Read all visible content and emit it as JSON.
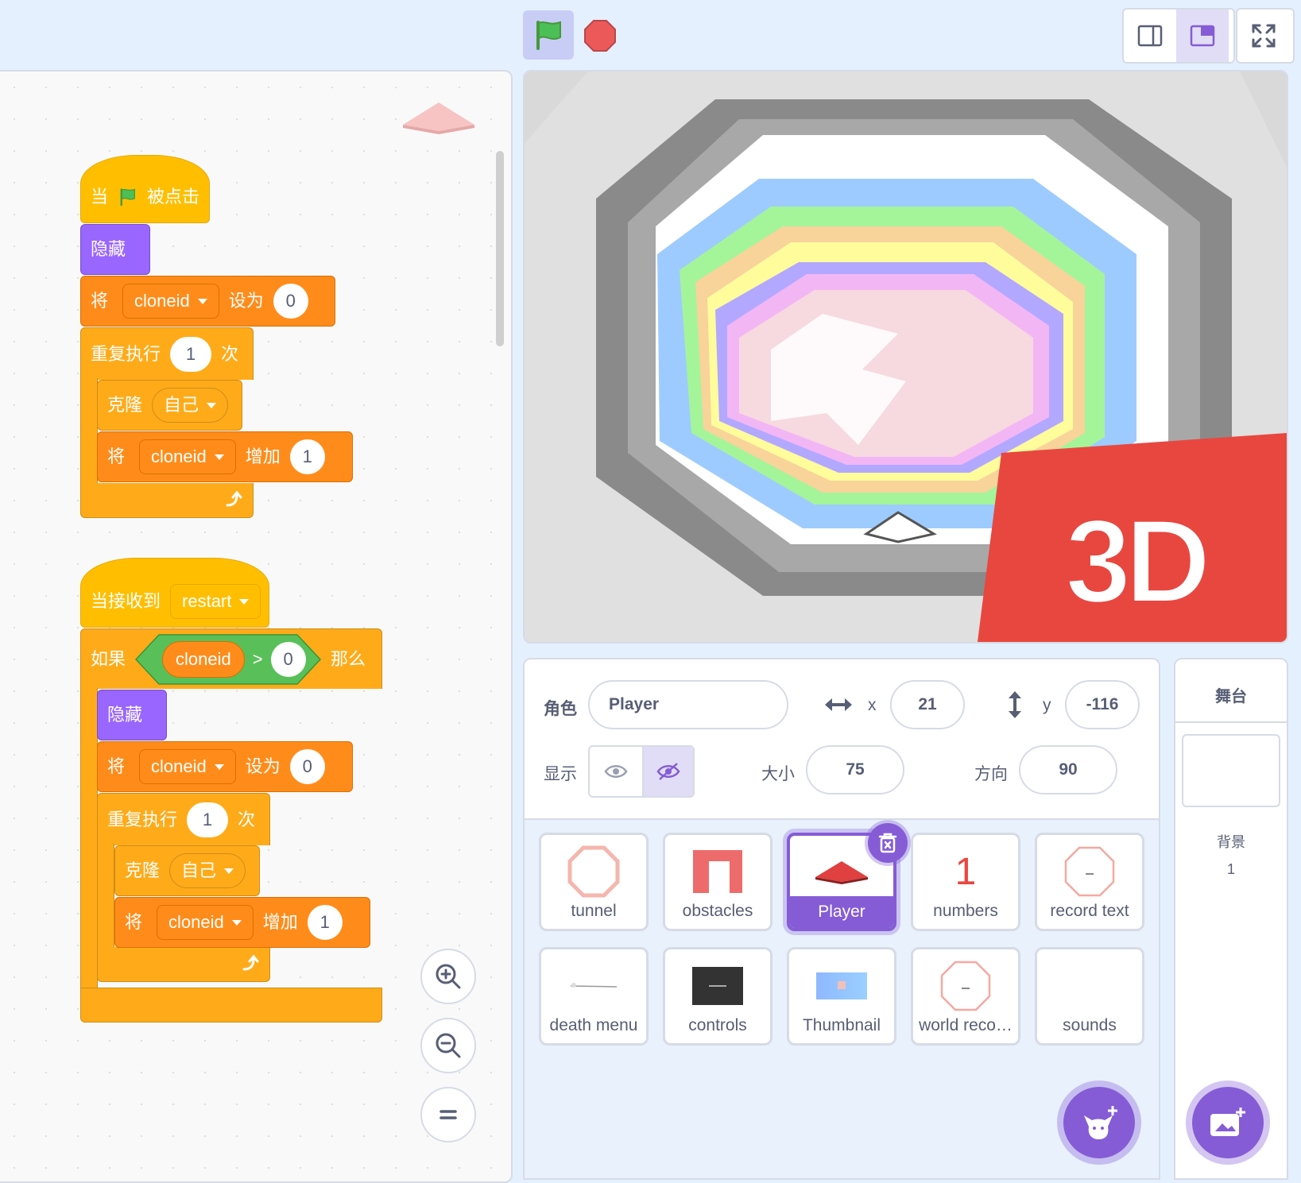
{
  "toolbar": {
    "green_flag_icon": "green-flag-icon",
    "stop_icon": "stop-icon",
    "modes": [
      "small-stage-icon",
      "normal-stage-icon",
      "fullscreen-icon"
    ]
  },
  "scripts": {
    "script1": {
      "hat_when": "当",
      "hat_clicked": "被点击",
      "hide": "隐藏",
      "set_label": "将",
      "set_var": "cloneid",
      "set_to": "设为",
      "set_value": "0",
      "repeat_label": "重复执行",
      "repeat_count": "1",
      "repeat_times": "次",
      "clone_label": "克隆",
      "clone_target": "自己",
      "change_label": "将",
      "change_var": "cloneid",
      "change_by": "增加",
      "change_value": "1"
    },
    "script2": {
      "hat_receive": "当接收到",
      "message": "restart",
      "if_label": "如果",
      "cond_var": "cloneid",
      "cond_op": ">",
      "cond_value": "0",
      "then_label": "那么",
      "hide": "隐藏",
      "set_label": "将",
      "set_var": "cloneid",
      "set_to": "设为",
      "set_value": "0",
      "repeat_label": "重复执行",
      "repeat_count": "1",
      "repeat_times": "次",
      "clone_label": "克隆",
      "clone_target": "自己",
      "change_label": "将",
      "change_var": "cloneid",
      "change_by": "增加",
      "change_value": "1"
    }
  },
  "zoom": [
    "zoom-in-icon",
    "zoom-out-icon",
    "zoom-reset-icon"
  ],
  "stage_overlay": {
    "badge": "3D"
  },
  "sprite_info": {
    "sprite_label": "角色",
    "sprite_name": "Player",
    "x_label": "x",
    "x_value": "21",
    "y_label": "y",
    "y_value": "-116",
    "show_label": "显示",
    "size_label": "大小",
    "size_value": "75",
    "direction_label": "方向",
    "direction_value": "90"
  },
  "sprites": [
    {
      "name": "tunnel"
    },
    {
      "name": "obstacles"
    },
    {
      "name": "Player"
    },
    {
      "name": "numbers"
    },
    {
      "name": "record text"
    },
    {
      "name": "death menu"
    },
    {
      "name": "controls"
    },
    {
      "name": "Thumbnail"
    },
    {
      "name": "world reco…"
    },
    {
      "name": "sounds"
    }
  ],
  "numbers_thumb": "1",
  "stage_panel": {
    "title": "舞台",
    "backdrops_label": "背景",
    "backdrops_count": "1"
  },
  "colors": {
    "events": "#ffbf00",
    "looks": "#9966ff",
    "variables": "#ff8c1a",
    "control": "#ffab19",
    "operators": "#59c059",
    "accent": "#855cd6",
    "badge_red": "#e8473f"
  }
}
